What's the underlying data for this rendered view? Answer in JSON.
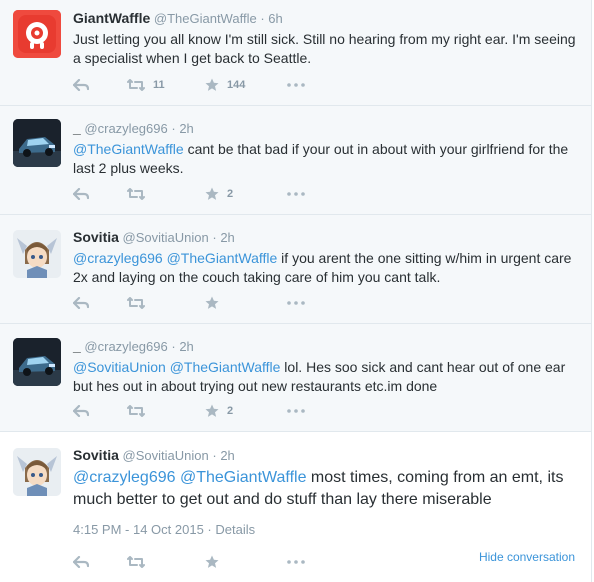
{
  "tweets": [
    {
      "name": "GiantWaffle",
      "handle": "@TheGiantWaffle",
      "time": "6h",
      "text": "Just letting you all know I'm still sick. Still no hearing from my right ear. I'm seeing a specialist when I get back to Seattle.",
      "retweets": "11",
      "likes": "144"
    },
    {
      "name": "_",
      "handle": "@crazyleg696",
      "time": "2h",
      "mention1": "@TheGiantWaffle",
      "text": " cant be that bad if your out in about with your girlfriend for the last 2 plus weeks.",
      "retweets": "",
      "likes": "2"
    },
    {
      "name": "Sovitia",
      "handle": "@SovitiaUnion",
      "time": "2h",
      "mention1": "@crazyleg696",
      "mention2": "@TheGiantWaffle",
      "text": " if you arent the one sitting w/him in urgent care 2x and laying on the couch taking care of him you cant talk.",
      "retweets": "",
      "likes": ""
    },
    {
      "name": "_",
      "handle": "@crazyleg696",
      "time": "2h",
      "mention1": "@SovitiaUnion",
      "mention2": "@TheGiantWaffle",
      "text": " lol. Hes soo sick and cant hear out of one ear but hes out in about trying out new restaurants etc.im done",
      "retweets": "",
      "likes": "2"
    },
    {
      "name": "Sovitia",
      "handle": "@SovitiaUnion",
      "time": "2h",
      "mention1": "@crazyleg696",
      "mention2": "@TheGiantWaffle",
      "text": " most times, coming from an emt, its much better to get out and do stuff than lay there miserable",
      "timestamp": "4:15 PM - 14 Oct 2015",
      "details_label": "Details",
      "hide_label": "Hide conversation"
    }
  ],
  "separator": "·",
  "colors": {
    "link": "#3b94d9",
    "muted": "#8899a6",
    "icon": "#aab8c2",
    "background": "#f5f8fa"
  }
}
